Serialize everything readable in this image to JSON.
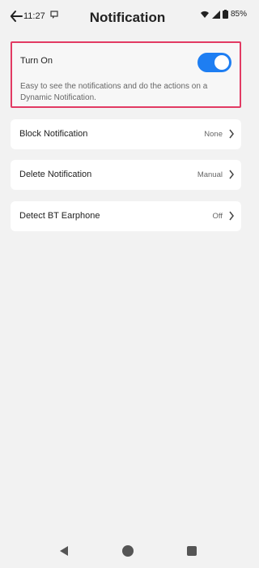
{
  "status": {
    "time": "11:27",
    "battery": "85%",
    "icons": [
      "status-notification-icon",
      "wifi-icon",
      "signal-icon",
      "battery-icon"
    ]
  },
  "header": {
    "title": "Notification",
    "back_icon": "back-arrow-icon"
  },
  "turn_on": {
    "label": "Turn On",
    "state": "on",
    "description": "Easy to see the notifications and do the actions on a Dynamic Notification."
  },
  "settings": [
    {
      "label": "Block Notification",
      "value": "None"
    },
    {
      "label": "Delete Notification",
      "value": "Manual"
    },
    {
      "label": "Detect BT Earphone",
      "value": "Off"
    }
  ],
  "nav": {
    "back_icon": "triangle-back-icon",
    "home_icon": "circle-home-icon",
    "recents_icon": "square-recents-icon"
  },
  "colors": {
    "accent": "#1e7ef2",
    "highlight_border": "#e23a63",
    "background": "#f2f2f2"
  }
}
